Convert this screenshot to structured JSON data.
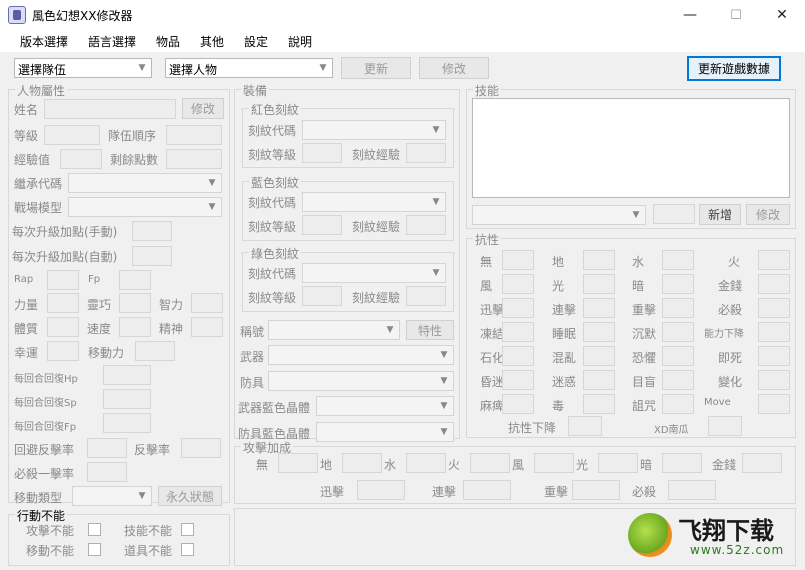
{
  "window": {
    "title": "風色幻想XX修改器",
    "minimize": "—",
    "maximize": "☐",
    "close": "✕"
  },
  "menu": [
    "版本選擇",
    "語言選擇",
    "物品",
    "其他",
    "設定",
    "說明"
  ],
  "toolbar": {
    "party_select": "選擇隊伍",
    "character_select": "選擇人物",
    "refresh": "更新",
    "modify": "修改",
    "update_data": "更新遊戲數據"
  },
  "attributes": {
    "title": "人物屬性",
    "name": "姓名",
    "modify": "修改",
    "level": "等級",
    "team_order": "隊伍順序",
    "exp": "經驗值",
    "remaining_points": "剩餘點數",
    "inherit_code": "繼承代碼",
    "battle_model": "戰場模型",
    "per_level_manual": "每次升級加點(手動)",
    "per_level_auto": "每次升級加點(自動)",
    "rap": "Rap",
    "fp": "Fp",
    "strength": "力量",
    "dexterity": "靈巧",
    "intellect": "智力",
    "constitution": "體質",
    "speed": "速度",
    "spirit": "精神",
    "luck": "幸運",
    "movement": "移動力",
    "hp_regen": "每回合回復Hp",
    "sp_regen": "每回合回復Sp",
    "fp_regen": "每回合回復Fp",
    "evade_counter": "回避反擊率",
    "counter": "反擊率",
    "crit_rate": "必殺一擊率",
    "move_type": "移動類型",
    "permanent": "永久狀態"
  },
  "action_disable": {
    "title": "行動不能",
    "attack": "攻擊不能",
    "skill": "技能不能",
    "move": "移動不能",
    "item": "道具不能"
  },
  "equipment": {
    "title": "裝備",
    "red": {
      "title": "紅色刻紋",
      "code": "刻紋代碼",
      "level": "刻紋等級",
      "exp": "刻紋經驗"
    },
    "blue": {
      "title": "藍色刻紋",
      "code": "刻紋代碼",
      "level": "刻紋等級",
      "exp": "刻紋經驗"
    },
    "green": {
      "title": "綠色刻紋",
      "code": "刻紋代碼",
      "level": "刻紋等級",
      "exp": "刻紋經驗"
    },
    "nickname": "稱號",
    "trait": "特性",
    "weapon": "武器",
    "armor": "防具",
    "weapon_crystal": "武器藍色晶體",
    "armor_crystal": "防具藍色晶體"
  },
  "skills": {
    "title": "技能",
    "add": "新增",
    "modify": "修改"
  },
  "resist": {
    "title": "抗性",
    "labels": [
      [
        "無",
        "地",
        "水",
        "火"
      ],
      [
        "風",
        "光",
        "暗",
        "金錢"
      ],
      [
        "迅擊",
        "連擊",
        "重擊",
        "必殺"
      ],
      [
        "凍結",
        "睡眠",
        "沉默",
        "能力下降"
      ],
      [
        "石化",
        "混亂",
        "恐懼",
        "即死"
      ],
      [
        "昏迷",
        "迷惑",
        "目盲",
        "變化"
      ],
      [
        "麻痺",
        "毒",
        "詛咒",
        "Move"
      ]
    ],
    "resist_down": "抗性下降",
    "xd_label": "XD南瓜"
  },
  "attack_bonus": {
    "title": "攻擊加成",
    "row1": [
      "無",
      "地",
      "水",
      "火",
      "風",
      "光",
      "暗",
      "金錢"
    ],
    "row2": [
      "迅擊",
      "連擊",
      "重擊",
      "必殺"
    ]
  },
  "watermark": {
    "brand": "飞翔下载",
    "url": "www.52z.com"
  }
}
